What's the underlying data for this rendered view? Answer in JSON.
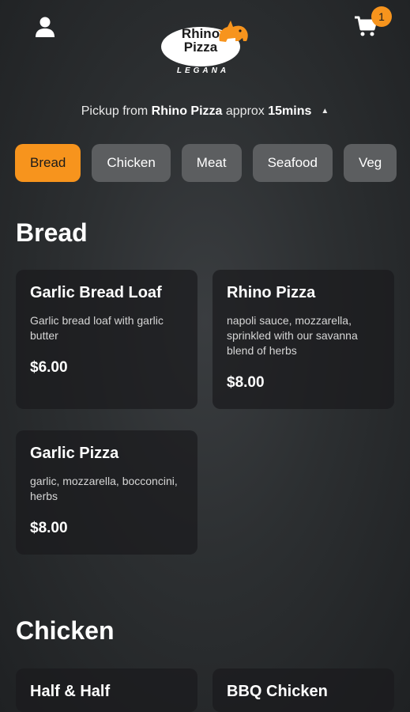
{
  "header": {
    "logo": {
      "line1": "Rhino",
      "line2": "Pizza",
      "subtitle": "LEGANA"
    },
    "cart_count": "1"
  },
  "pickup": {
    "prefix": "Pickup from ",
    "store": "Rhino Pizza",
    "middle": " approx ",
    "time": "15mins"
  },
  "tabs": [
    {
      "label": "Bread",
      "active": true
    },
    {
      "label": "Chicken"
    },
    {
      "label": "Meat"
    },
    {
      "label": "Seafood"
    },
    {
      "label": "Veg"
    }
  ],
  "sections": [
    {
      "title": "Bread",
      "items": [
        {
          "name": "Garlic Bread Loaf",
          "description": "Garlic bread loaf with garlic butter",
          "price": "$6.00"
        },
        {
          "name": "Rhino Pizza",
          "description": "napoli sauce, mozzarella, sprinkled with our savanna blend of herbs",
          "price": "$8.00"
        },
        {
          "name": "Garlic Pizza",
          "description": "garlic, mozzarella, bocconcini, herbs",
          "price": "$8.00"
        }
      ]
    },
    {
      "title": "Chicken",
      "items": [
        {
          "name": "Half & Half"
        },
        {
          "name": "BBQ Chicken"
        }
      ]
    }
  ],
  "colors": {
    "accent": "#f7941d",
    "tab_inactive": "#5c5e60",
    "card_bg": "#1a1b1d"
  },
  "icons": {
    "user": "user-icon",
    "cart": "cart-icon",
    "caret": "caret-up-icon"
  }
}
